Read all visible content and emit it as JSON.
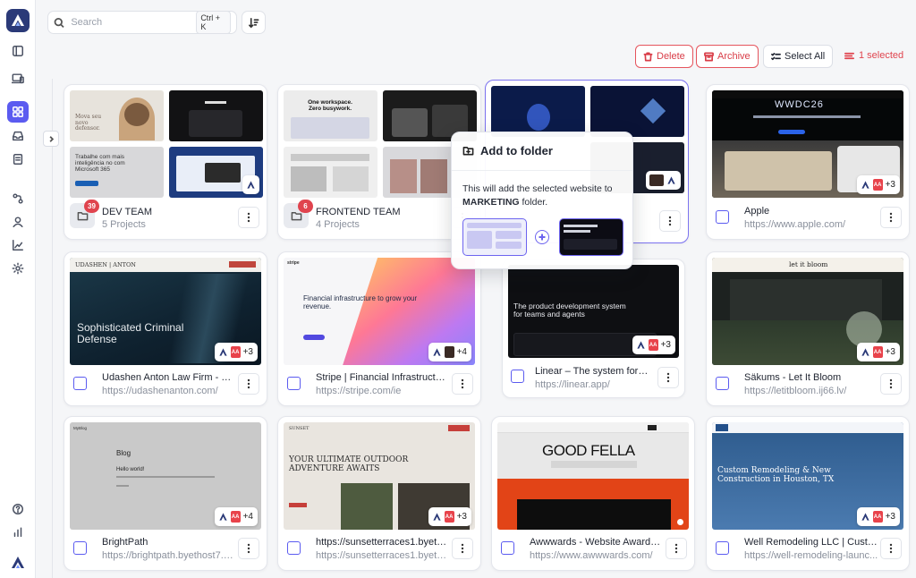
{
  "search": {
    "placeholder": "Search",
    "shortcut": "Ctrl + K"
  },
  "toolbar": {
    "delete_label": "Delete",
    "archive_label": "Archive",
    "select_all_label": "Select All",
    "selected_label": "1 selected"
  },
  "colors": {
    "accent": "#5b5bf0",
    "danger": "#e0444e",
    "brand": "#2b3a78"
  },
  "nav_icons": [
    "logo-icon",
    "sidebar-toggle-icon",
    "devices-icon",
    "grid-icon",
    "inbox-icon",
    "document-icon",
    "workflow-icon",
    "user-icon",
    "chart-icon",
    "settings-icon",
    "help-icon",
    "stats-icon"
  ],
  "folders": [
    {
      "name": "DEV TEAM",
      "subtitle": "5 Projects",
      "count": "39"
    },
    {
      "name": "FRONTEND TEAM",
      "subtitle": "4 Projects",
      "count": "6"
    }
  ],
  "thumb_text": {
    "devteam": {
      "q1": "Mova seu novo defensor.",
      "q3": "Trabalhe com mais inteligência no com Microsoft 365"
    },
    "frontend": {
      "q1": "One workspace. Zero busywork."
    },
    "apple": {
      "headline": "WWDC26"
    },
    "udashen": {
      "brand": "UDASHEN | ANTON",
      "headline": "Sophisticated Criminal Defense"
    },
    "stripe": {
      "headline": "Financial infrastructure to grow your revenue."
    },
    "linear": {
      "headline": "The product development system for teams and agents"
    },
    "sakums": {
      "brand": "let it bloom"
    },
    "blog": {
      "brand": "MyBlog",
      "title": "Blog",
      "post": "Hello world!"
    },
    "sunset": {
      "brand": "SUNSET",
      "headline": "YOUR ULTIMATE OUTDOOR ADVENTURE AWAITS"
    },
    "awwwards": {
      "headline": "GOOD FELLA"
    },
    "wellremodel": {
      "headline": "Custom Remodeling & New Construction in Houston, TX"
    }
  },
  "sites": [
    {
      "title": "Apple",
      "url": "https://www.apple.com/",
      "extra": "+3"
    },
    {
      "title": "Udashen Anton Law Firm - Cr...",
      "url": "https://udashenanton.com/",
      "extra": "+3"
    },
    {
      "title": "Stripe | Financial Infrastructur...",
      "url": "https://stripe.com/ie",
      "extra": "+4"
    },
    {
      "title": "Linear – The system for prod...",
      "url": "https://linear.app/",
      "extra": "+3"
    },
    {
      "title": "Säkums - Let It Bloom",
      "url": "https://letitbloom.ij66.lv/",
      "extra": "+3"
    },
    {
      "title": "BrightPath",
      "url": "https://brightpath.byethost7.c...",
      "extra": "+4"
    },
    {
      "title": "https://sunsetterraces1.byeth...",
      "url": "https://sunsetterraces1.byeth...",
      "extra": "+3"
    },
    {
      "title": "Awwwards - Website Awards ...",
      "url": "https://www.awwwards.com/",
      "extra": ""
    },
    {
      "title": "Well Remodeling LLC | Custo...",
      "url": "https://well-remodeling-launc...",
      "extra": "+3"
    }
  ],
  "popover": {
    "title": "Add to folder",
    "body_prefix": "This will add the selected website to ",
    "folder": "MARKETING",
    "body_suffix": " folder."
  },
  "marketing_card": {
    "extra": ""
  }
}
